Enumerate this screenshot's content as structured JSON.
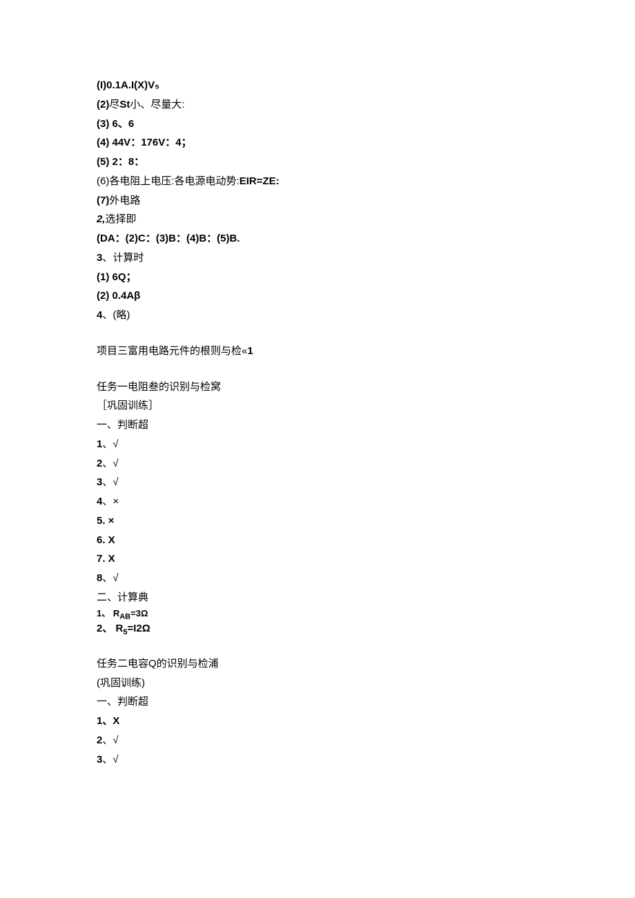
{
  "section1": {
    "l1": "(I)0.1A.I(X)V₅",
    "l2_a": "(2)",
    "l2_b": "尽",
    "l2_c": "St",
    "l2_d": "小、尽量大:",
    "l3": "(3)     6、6",
    "l4": "(4)     44V：176V：4；",
    "l5": "(5)     2：8：",
    "l6_a": "(6)",
    "l6_b": "各电阻上电压:各电源电动势:",
    "l6_c": "EIR=ZE:",
    "l7_a": "(7)",
    "l7_b": "外电路",
    "l8_a": "2,",
    "l8_b": "选择即",
    "l9": "(DA：(2)C：(3)B：(4)B：(5)B.",
    "l10_a": "3",
    "l10_b": "、计算时",
    "l11": "(1)     6Q；",
    "l12": "(2)     0.4Aβ",
    "l13_a": "4",
    "l13_b": "、(略)"
  },
  "section2": {
    "title_a": "项目三富用电路元件的根则与检«",
    "title_b": "1"
  },
  "section3": {
    "title": "任务一电阻叁的识别与检窝",
    "sub": " ［巩固训练］",
    "h1": "一、判断超",
    "j1_a": "1",
    "j1_b": "、√",
    "j2_a": "2",
    "j2_b": "、√",
    "j3_a": "3",
    "j3_b": "、√",
    "j4_a": "4",
    "j4_b": "、×",
    "j5": "5.    ×",
    "j6": "6.    X",
    "j7": "7.    X",
    "j8_a": "8",
    "j8_b": "、√",
    "h2": "二、计算典",
    "c1_a": "1、  R",
    "c1_sub": "AB",
    "c1_b": "=3Ω",
    "c2_a": "2、  R",
    "c2_sub": "5",
    "c2_b": "=I2Ω"
  },
  "section4": {
    "title": "任务二电容Q的识别与检浦",
    "sub": "(巩固训练)",
    "h1": "一、判断超",
    "j1_a": "1",
    "j1_b": "、X",
    "j2_a": "2",
    "j2_b": "、√",
    "j3_a": "3",
    "j3_b": "、√"
  }
}
